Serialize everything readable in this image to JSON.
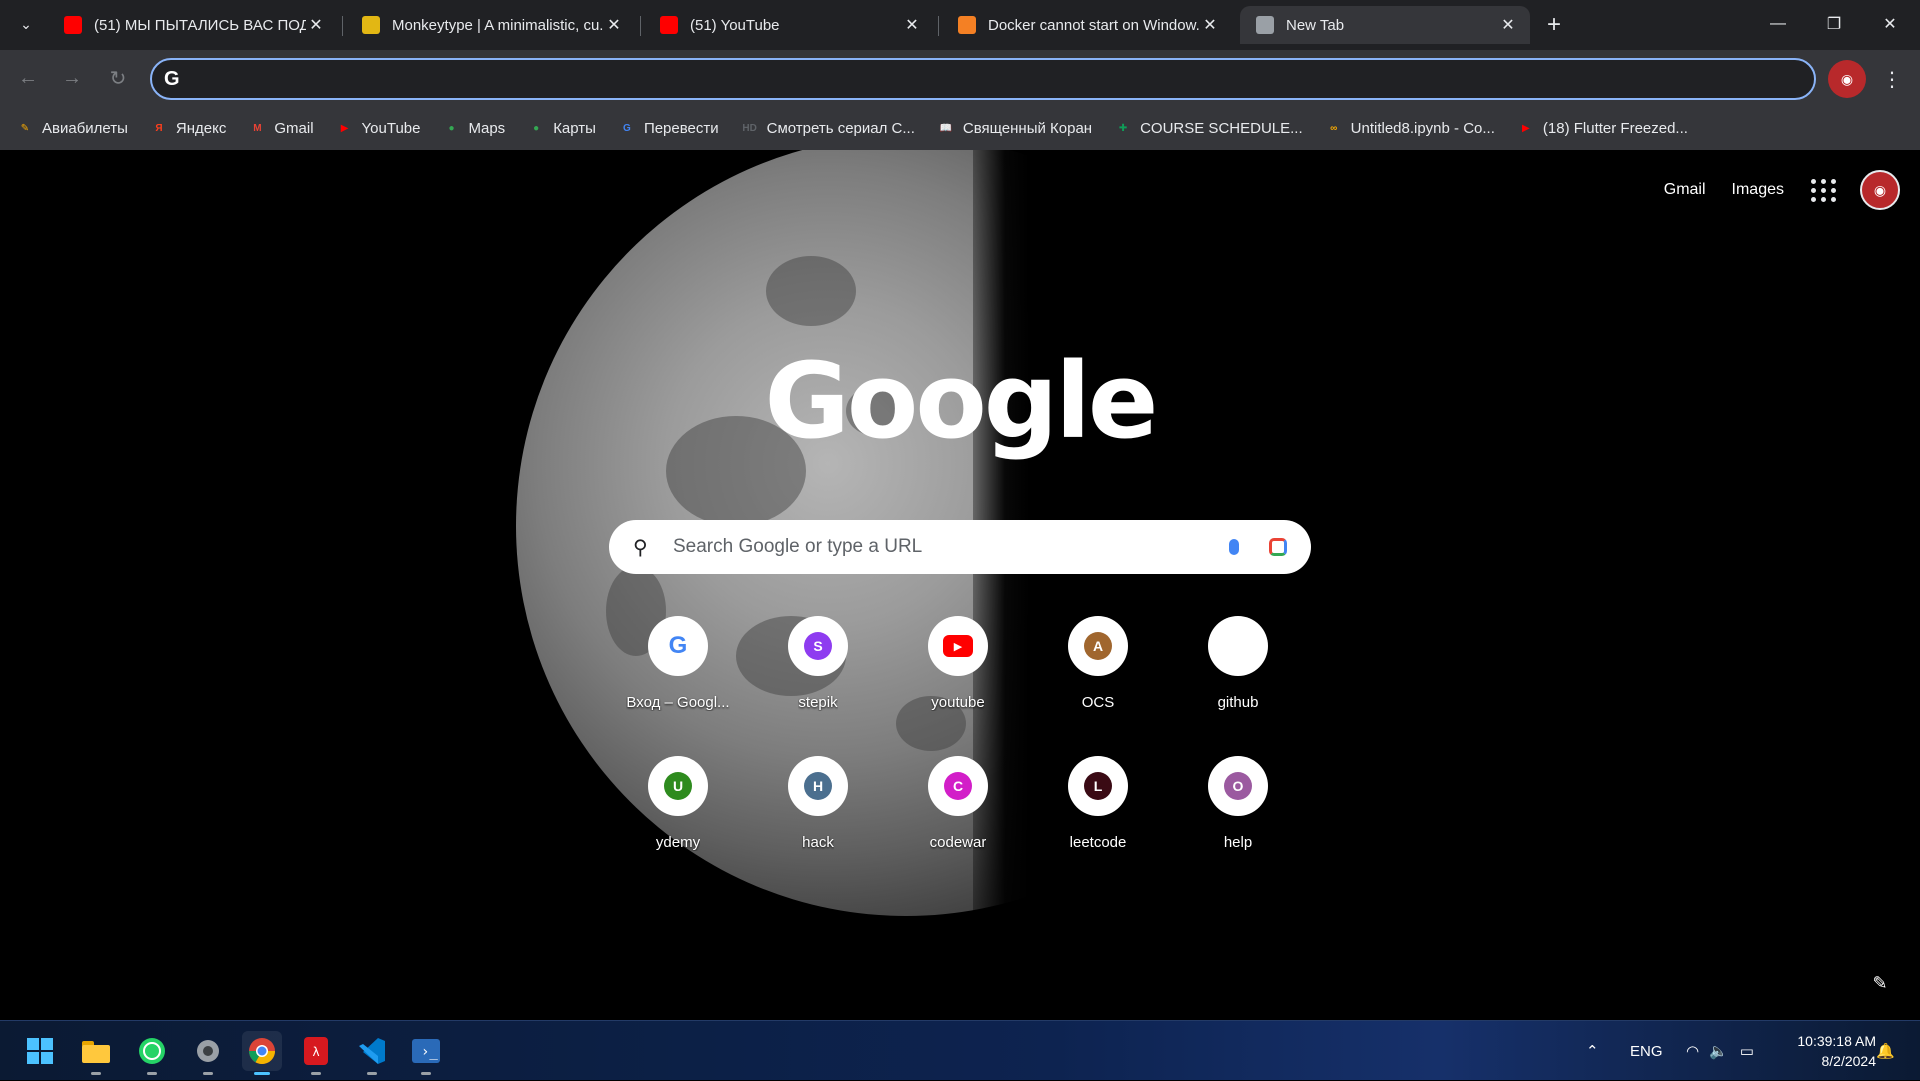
{
  "tabs": [
    {
      "title": "(51) МЫ ПЫТАЛИСЬ ВАС ПОД...",
      "favicon": "youtube-icon",
      "color": "#ff0000",
      "active": false
    },
    {
      "title": "Monkeytype | A minimalistic, cu...",
      "favicon": "monkeytype-icon",
      "color": "#e2b714",
      "active": false
    },
    {
      "title": "(51) YouTube",
      "favicon": "youtube-icon",
      "color": "#ff0000",
      "active": false
    },
    {
      "title": "Docker cannot start on Window...",
      "favicon": "stackoverflow-icon",
      "color": "#f48024",
      "active": false
    },
    {
      "title": "New Tab",
      "favicon": "chrome-icon",
      "color": "#9aa0a6",
      "active": true
    }
  ],
  "toolbar": {
    "omnibox_value": "",
    "omnibox_icon": "G"
  },
  "bookmarks": [
    {
      "label": "Авиабилеты",
      "icon": "pencil-icon",
      "color": "#f9ab00",
      "glyph": "✎"
    },
    {
      "label": "Яндекс",
      "icon": "yandex-icon",
      "color": "#fc3f1d",
      "glyph": "Я"
    },
    {
      "label": "Gmail",
      "icon": "gmail-icon",
      "color": "#ea4335",
      "glyph": "M"
    },
    {
      "label": "YouTube",
      "icon": "youtube-icon",
      "color": "#ff0000",
      "glyph": "▶"
    },
    {
      "label": "Maps",
      "icon": "maps-pin-icon",
      "color": "#34a853",
      "glyph": "●"
    },
    {
      "label": "Карты",
      "icon": "maps-pin-icon",
      "color": "#34a853",
      "glyph": "●"
    },
    {
      "label": "Перевести",
      "icon": "translate-icon",
      "color": "#4285f4",
      "glyph": "G"
    },
    {
      "label": "Смотреть сериал С...",
      "icon": "hd-icon",
      "color": "#5f6368",
      "glyph": "HD"
    },
    {
      "label": "Священный Коран",
      "icon": "book-icon",
      "color": "#bdbdbd",
      "glyph": "📖"
    },
    {
      "label": "COURSE SCHEDULE...",
      "icon": "sheets-icon",
      "color": "#0f9d58",
      "glyph": "✚"
    },
    {
      "label": "Untitled8.ipynb - Co...",
      "icon": "colab-icon",
      "color": "#f9ab00",
      "glyph": "∞"
    },
    {
      "label": "(18) Flutter Freezed...",
      "icon": "youtube-icon",
      "color": "#ff0000",
      "glyph": "▶"
    }
  ],
  "ntp": {
    "links": {
      "gmail": "Gmail",
      "images": "Images"
    },
    "logo": "Google",
    "search_placeholder": "Search Google or type a URL",
    "shortcuts": [
      {
        "label": "Вход – Googl...",
        "letter": "G",
        "color": "#4285f4",
        "type": "google"
      },
      {
        "label": "stepik",
        "letter": "S",
        "color": "#8e3cf0",
        "type": "letter"
      },
      {
        "label": "youtube",
        "letter": "▶",
        "color": "#ff0000",
        "type": "youtube"
      },
      {
        "label": "OCS",
        "letter": "A",
        "color": "#a0662e",
        "type": "letter"
      },
      {
        "label": "github",
        "letter": "",
        "color": "#ffffff",
        "type": "blank"
      },
      {
        "label": "ydemy",
        "letter": "U",
        "color": "#2e8b1e",
        "type": "letter"
      },
      {
        "label": "hack",
        "letter": "H",
        "color": "#4b6f8f",
        "type": "letter"
      },
      {
        "label": "codewar",
        "letter": "C",
        "color": "#d21ec8",
        "type": "letter"
      },
      {
        "label": "leetcode",
        "letter": "L",
        "color": "#3a0a14",
        "type": "letter"
      },
      {
        "label": "help",
        "letter": "O",
        "color": "#9b5aa0",
        "type": "letter"
      }
    ]
  },
  "taskbar": {
    "apps": [
      {
        "name": "start-button",
        "icon": "windows-icon"
      },
      {
        "name": "file-explorer",
        "icon": "folder-icon"
      },
      {
        "name": "whatsapp",
        "icon": "whatsapp-icon"
      },
      {
        "name": "settings",
        "icon": "gear-icon"
      },
      {
        "name": "chrome",
        "icon": "chrome-icon"
      },
      {
        "name": "acrobat",
        "icon": "pdf-icon"
      },
      {
        "name": "vscode",
        "icon": "vscode-icon"
      },
      {
        "name": "powershell",
        "icon": "terminal-icon"
      }
    ],
    "language": "ENG",
    "time": "10:39:18 AM",
    "date": "8/2/2024"
  }
}
